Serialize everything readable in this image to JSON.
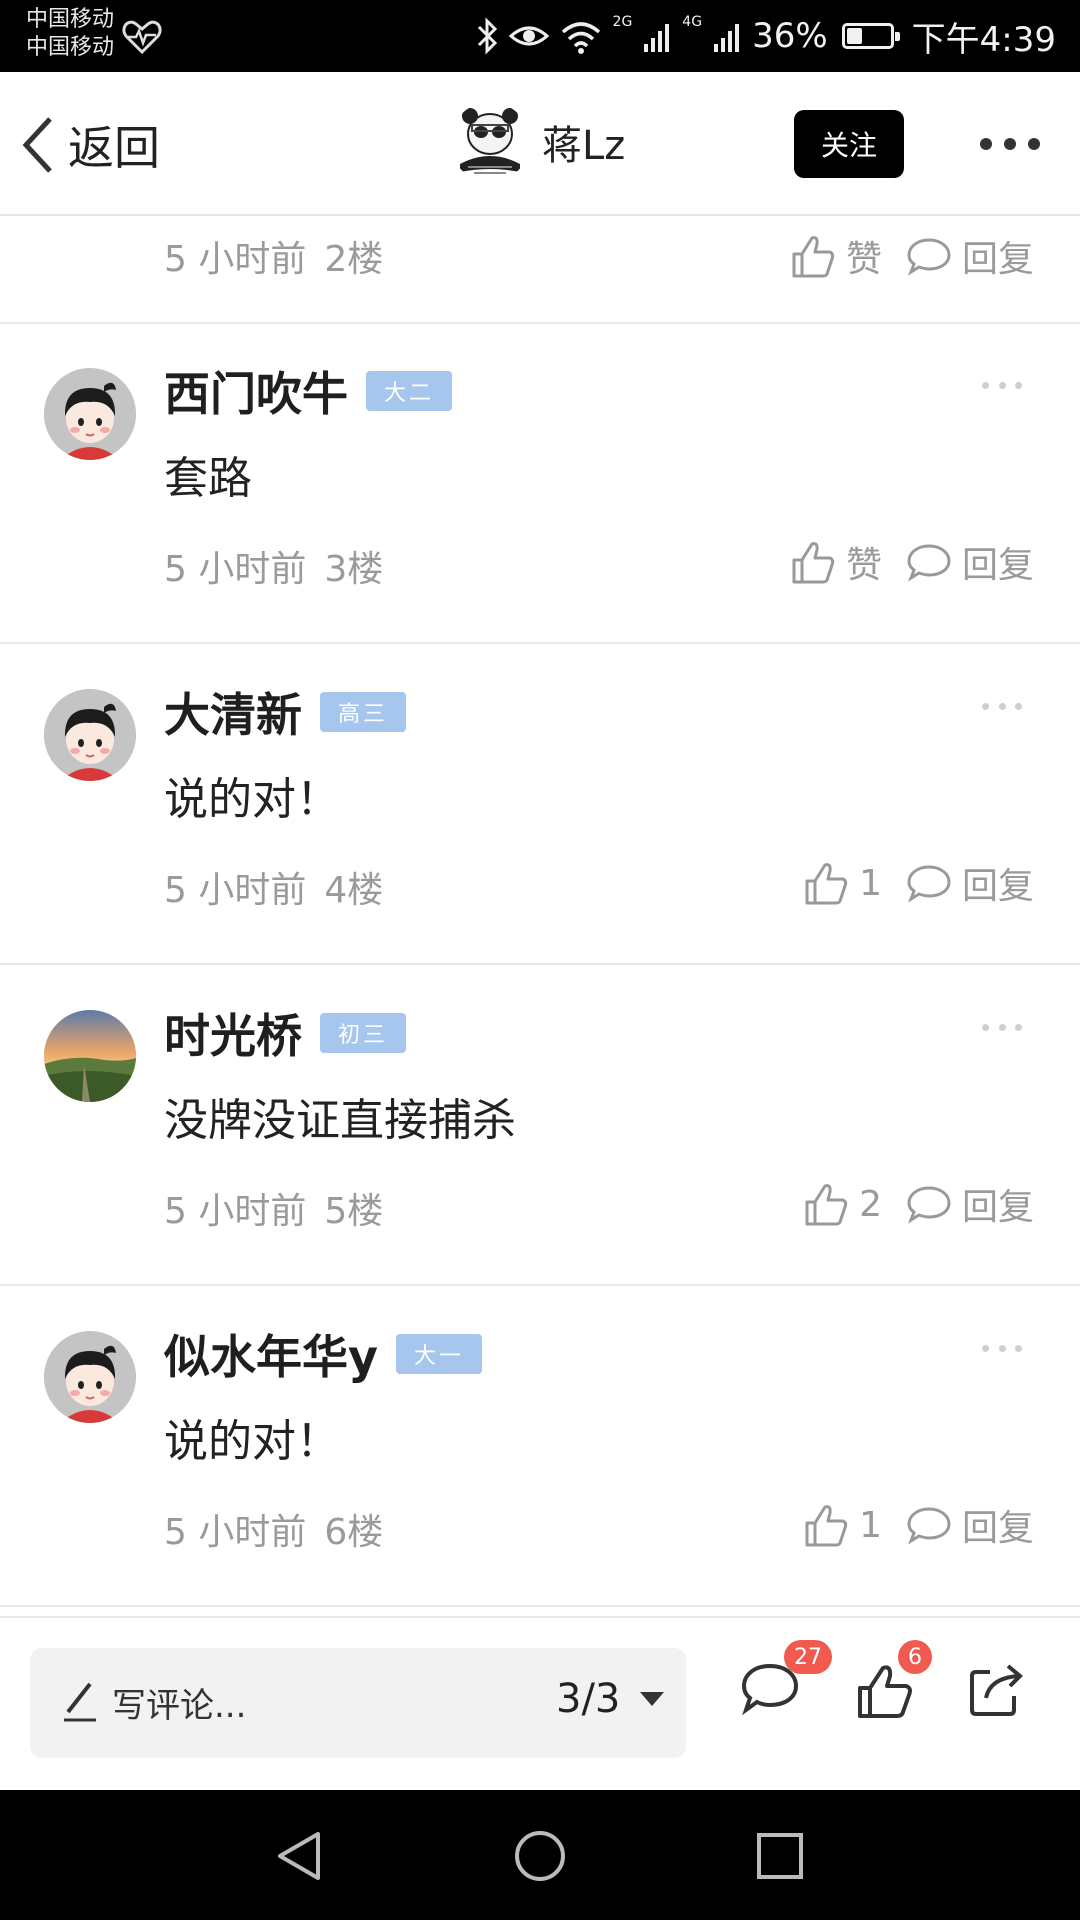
{
  "status_bar": {
    "carrier1": "中国移动",
    "carrier2": "中国移动",
    "network1": "2G",
    "network2": "4G",
    "battery": "36%",
    "battery_level": 0.36,
    "time": "下午4:39"
  },
  "header": {
    "back_label": "返回",
    "author_name": "蒋Lz",
    "follow_label": "关注"
  },
  "partial_comment": {
    "time": "5 小时前",
    "floor": "2楼",
    "like_label": "赞",
    "reply_label": "回复"
  },
  "comments": [
    {
      "name": "西门吹牛",
      "badge": "大二",
      "content": "套路",
      "time": "5 小时前",
      "floor": "3楼",
      "likes": "赞",
      "reply": "回复",
      "avatar": "cartoon"
    },
    {
      "name": "大清新",
      "badge": "高三",
      "content": "说的对！",
      "time": "5 小时前",
      "floor": "4楼",
      "likes": "1",
      "reply": "回复",
      "avatar": "cartoon"
    },
    {
      "name": "时光桥",
      "badge": "初三",
      "content": "没牌没证直接捕杀",
      "time": "5 小时前",
      "floor": "5楼",
      "likes": "2",
      "reply": "回复",
      "avatar": "landscape"
    },
    {
      "name": "似水年华y",
      "badge": "大一",
      "content": "说的对！",
      "time": "5 小时前",
      "floor": "6楼",
      "likes": "1",
      "reply": "回复",
      "avatar": "cartoon"
    }
  ],
  "bottom_bar": {
    "placeholder": "写评论...",
    "page": "3/3",
    "comment_count": "27",
    "like_count": "6"
  },
  "colors": {
    "badge": "#a7c6ee",
    "count_badge": "#f05a4f",
    "follow_button": "#000000"
  }
}
